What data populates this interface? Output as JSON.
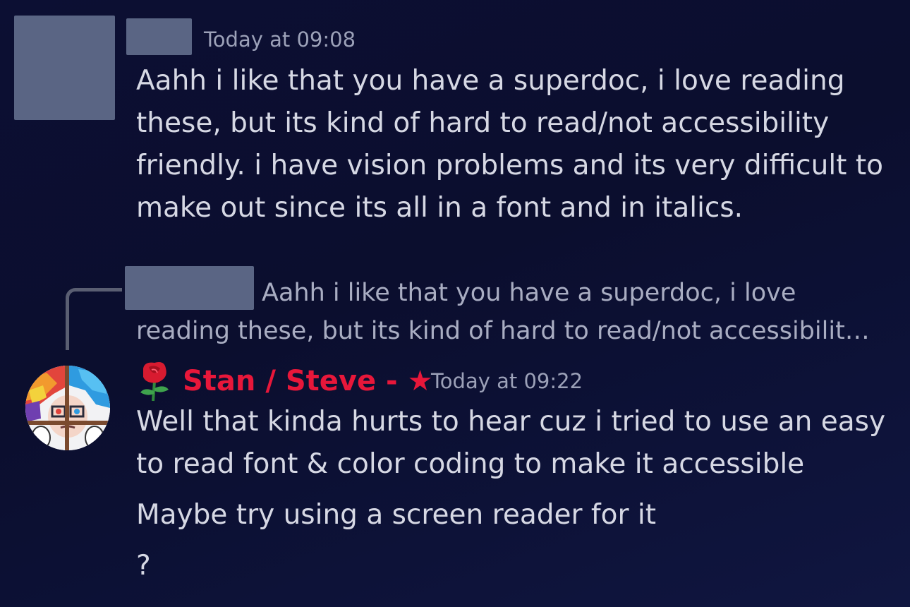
{
  "message1": {
    "timestamp": "Today at 09:08",
    "lines": [
      "Aahh i like that you have a superdoc, i love reading",
      "these, but its kind of hard to read/not accessibility",
      "friendly. i have vision problems and its very difficult to",
      "make out since its all in a font and in italics."
    ]
  },
  "reply": {
    "line1": "Aahh i like that you have a superdoc, i love",
    "line2": "reading these, but its kind of hard to read/not accessibilit…"
  },
  "message2": {
    "author": "Stan / Steve - ★",
    "author_color": "#e8173a",
    "timestamp": "Today at 09:22",
    "lines": [
      "Well that kinda hurts to hear cuz i tried to use an easy",
      "to read font & color coding to make it accessible"
    ]
  },
  "message3": {
    "text": "Maybe try using a screen reader for it"
  },
  "message4": {
    "text": "?"
  },
  "icons": {
    "author_prefix": "rose-emoji-icon",
    "avatar": "avatar-illustration"
  }
}
